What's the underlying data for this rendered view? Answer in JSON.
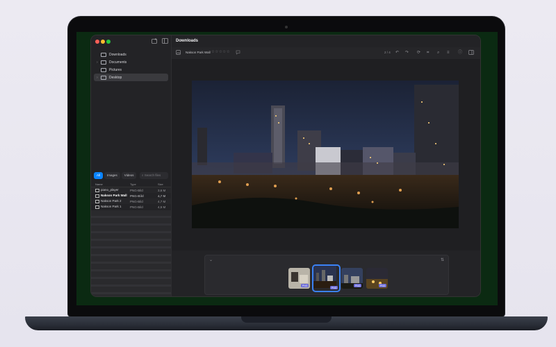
{
  "window": {
    "title": "Downloads"
  },
  "sidebar": {
    "tree": [
      {
        "label": "Downloads",
        "expandable": false,
        "selected": false
      },
      {
        "label": "Documents",
        "expandable": true,
        "selected": false
      },
      {
        "label": "Pictures",
        "expandable": false,
        "selected": false
      },
      {
        "label": "Desktop",
        "expandable": true,
        "selected": true
      }
    ],
    "filters": [
      "All",
      "Images",
      "Videos"
    ],
    "search_placeholder": "Search files",
    "columns": [
      "Name",
      "Type",
      "Size"
    ],
    "files": [
      {
        "name": "piano_player",
        "type": "PNG-Bild",
        "size": "3,6 M"
      },
      {
        "name": "Nakson Park Wall",
        "type": "PNG-Bild",
        "size": "4,7 M"
      },
      {
        "name": "Nakson Park 2",
        "type": "PNG-Bild",
        "size": "4,7 M"
      },
      {
        "name": "Nakson Park 1",
        "type": "PNG-Bild",
        "size": "4,5 M"
      }
    ]
  },
  "toolbar": {
    "file_name": "Nakson Park Wall",
    "rating_stars": "☆☆☆☆☆",
    "counter": "2 / 4"
  },
  "thumbnails": [
    {
      "badge": "PNG",
      "active": false
    },
    {
      "badge": "PNG",
      "active": true
    },
    {
      "badge": "PNG",
      "active": false
    },
    {
      "badge": "PNG",
      "active": false
    }
  ],
  "colors": {
    "accent": "#0a84ff",
    "active_border": "#3b82f6",
    "badge": "#6b6bd9"
  }
}
